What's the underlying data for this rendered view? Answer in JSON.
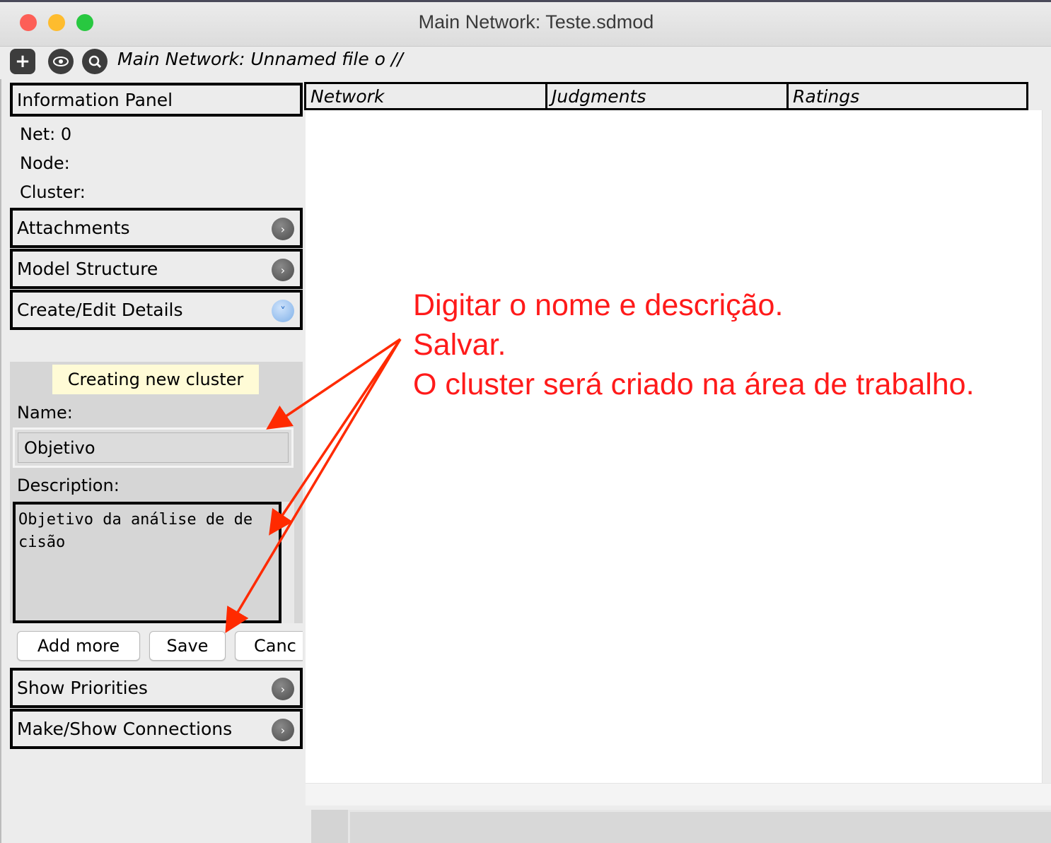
{
  "window": {
    "title": "Main Network: Teste.sdmod",
    "traffic_lights": {
      "close": "#fd5f57",
      "minimize": "#febc2e",
      "maximize": "#28c840"
    }
  },
  "toolbar": {
    "icons": [
      "plus-icon",
      "eye-icon",
      "search-network-icon"
    ],
    "title": "Main Network: Unnamed file o //"
  },
  "info_panel": {
    "header": "Information Panel",
    "net": "Net: 0",
    "node": "Node:",
    "cluster": "Cluster:"
  },
  "accordion": {
    "attachments": "Attachments",
    "model_structure": "Model Structure",
    "create_edit_details": "Create/Edit Details",
    "show_priorities": "Show Priorities",
    "make_show_connections": "Make/Show Connections"
  },
  "details": {
    "status": "Creating new cluster",
    "name_label": "Name:",
    "name_value": "Objetivo",
    "description_label": "Description:",
    "description_value": "Objetivo da análise de de\ncisão",
    "add_more": "Add more",
    "save": "Save",
    "cancel": "Canc"
  },
  "tabs": [
    "Network",
    "Judgments",
    "Ratings"
  ],
  "annotation": {
    "line1": "Digitar o nome e descrição.",
    "line2": "Salvar.",
    "line3": "O cluster será criado na área de trabalho.",
    "color": "#ff1a1a"
  }
}
